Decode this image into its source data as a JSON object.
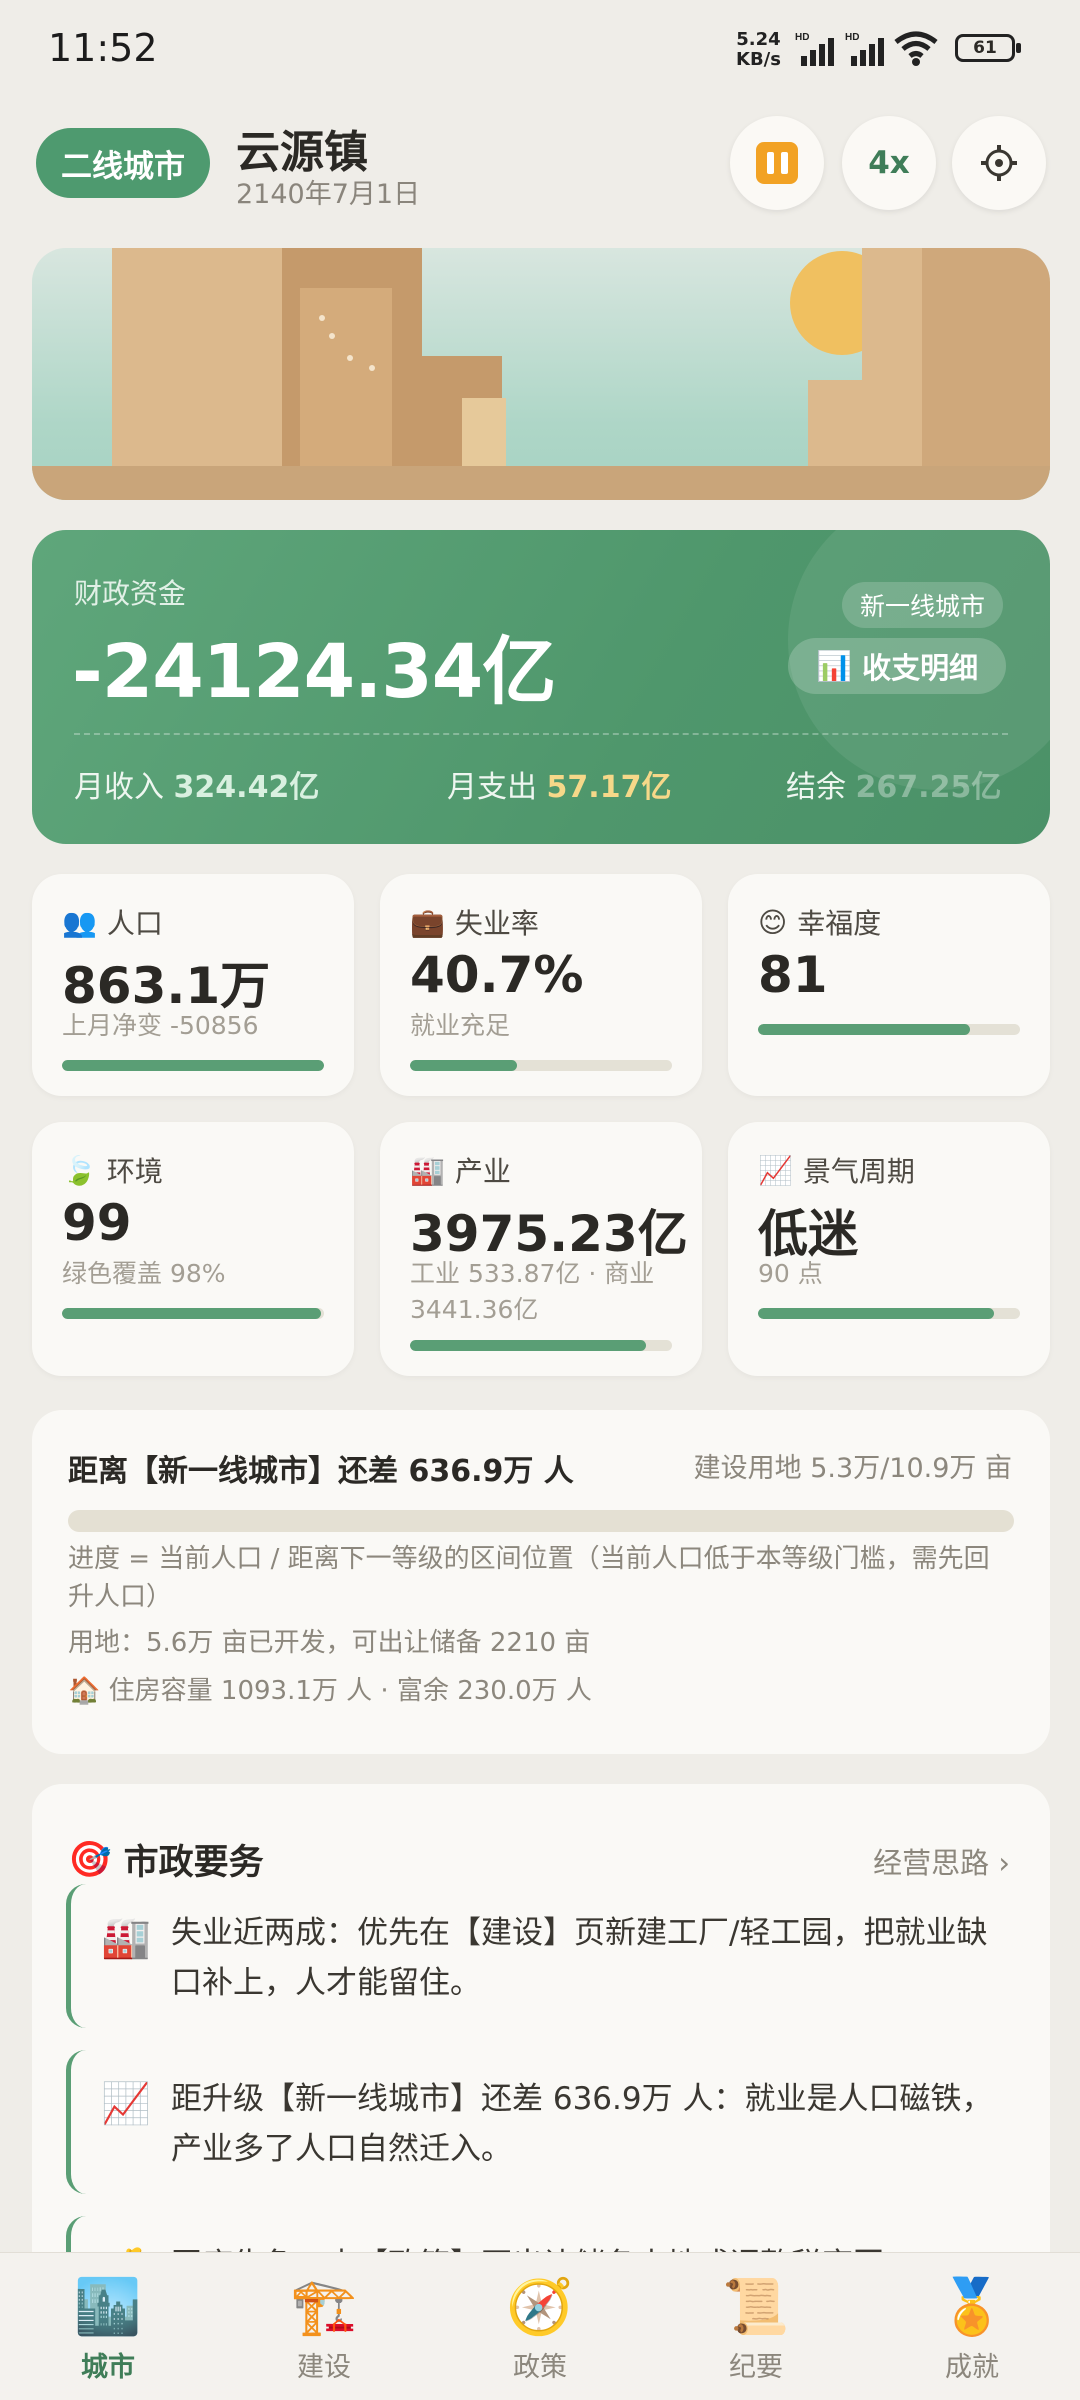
{
  "status": {
    "time": "11:52",
    "net_speed": "5.24",
    "net_unit": "KB/s",
    "battery": "61"
  },
  "header": {
    "tier": "二线城市",
    "city": "云源镇",
    "date": "2140年7月1日",
    "speed": "4x",
    "icons": {
      "pause": "pause-icon",
      "settings": "gear-icon"
    }
  },
  "finance": {
    "label": "财政资金",
    "amount": "-24124.34亿",
    "next_tier_tag": "新一线城市",
    "detail_label": "收支明细",
    "income_label": "月收入",
    "income": "324.42亿",
    "expense_label": "月支出",
    "expense": "57.17亿",
    "balance_label": "结余",
    "balance": "267.25亿"
  },
  "stats": [
    {
      "icon": "👥",
      "title": "人口",
      "value": "863.1万",
      "sub": "上月净变 -50856",
      "level": 1.0
    },
    {
      "icon": "💼",
      "title": "失业率",
      "value": "40.7%",
      "sub": "就业充足",
      "level": 0.41
    },
    {
      "icon": "😊",
      "title": "幸福度",
      "value": "81",
      "sub": "",
      "level": 0.81
    },
    {
      "icon": "🍃",
      "title": "环境",
      "value": "99",
      "sub": "绿色覆盖 98%",
      "level": 0.99
    },
    {
      "icon": "🏭",
      "title": "产业",
      "value": "3975.23亿",
      "sub": "工业 533.87亿 · 商业 3441.36亿",
      "level": 0.9
    },
    {
      "icon": "📈",
      "title": "景气周期",
      "value": "低迷",
      "sub": "90 点",
      "level": 0.9
    }
  ],
  "progress": {
    "title": "距离【新一线城市】还差 636.9万 人",
    "land": "建设用地 5.3万/10.9万 亩",
    "note": "进度 = 当前人口 / 距离下一等级的区间位置（当前人口低于本等级门槛，需先回升人口）",
    "land_detail": "用地：5.6万 亩已开发，可出让储备 2210 亩",
    "housing": "🏠 住房容量 1093.1万 人 · 富余 230.0万 人",
    "level": 0.0
  },
  "tasks": {
    "title": "市政要务",
    "link": "经营思路 ›",
    "items": [
      {
        "icon": "🏭",
        "text": "失业近两成：优先在【建设】页新建工厂/轻工园，把就业缺口补上，人才能留住。"
      },
      {
        "icon": "📈",
        "text": "距升级【新一线城市】还差 636.9万 人：就业是人口磁铁，产业多了人口自然迁入。"
      },
      {
        "icon": "💰",
        "text": "国库告急：去【政策】页出让储备土地或调整税率回"
      }
    ]
  },
  "nav": [
    {
      "icon": "🏙️",
      "label": "城市",
      "active": true
    },
    {
      "icon": "🏗️",
      "label": "建设",
      "active": false
    },
    {
      "icon": "🧭",
      "label": "政策",
      "active": false
    },
    {
      "icon": "📜",
      "label": "纪要",
      "active": false
    },
    {
      "icon": "🏅",
      "label": "成就",
      "active": false
    }
  ]
}
